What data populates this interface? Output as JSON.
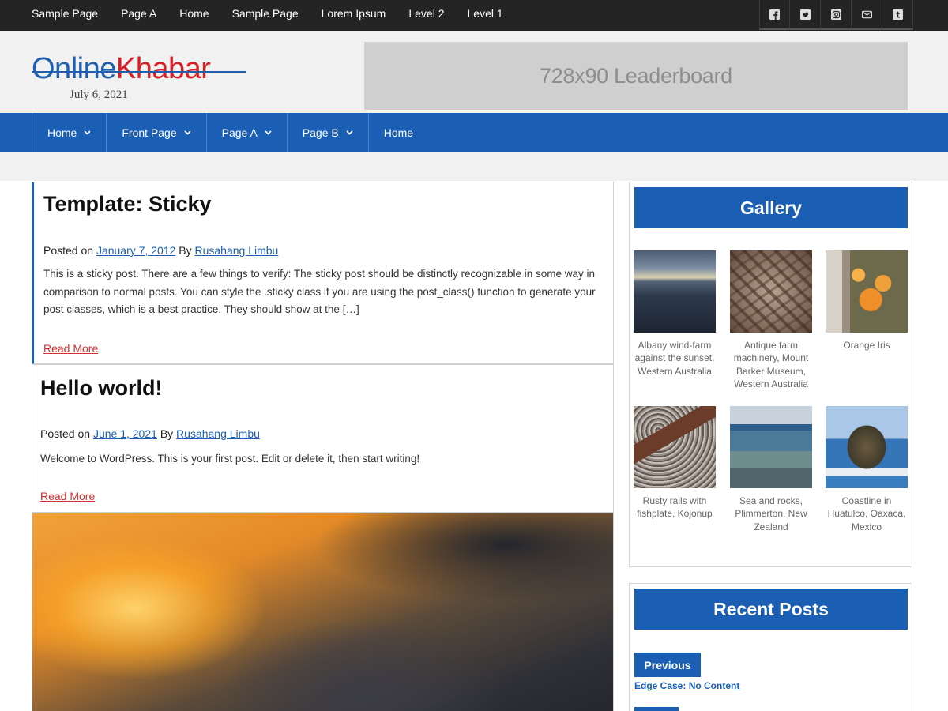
{
  "top_nav": {
    "items": [
      "Sample Page",
      "Page A",
      "Home",
      "Sample Page",
      "Lorem Ipsum",
      "Level 2",
      "Level 1"
    ]
  },
  "social_icons": [
    "facebook-icon",
    "twitter-icon",
    "instagram-icon",
    "email-icon",
    "tumblr-icon"
  ],
  "site": {
    "logo_part1": "Online",
    "logo_part2": "Khabar",
    "date": "July 6, 2021",
    "ad_label": "728x90 Leaderboard"
  },
  "main_nav": {
    "items": [
      {
        "label": "Home",
        "has_dropdown": true
      },
      {
        "label": "Front Page",
        "has_dropdown": true
      },
      {
        "label": "Page A",
        "has_dropdown": true
      },
      {
        "label": "Page B",
        "has_dropdown": true
      },
      {
        "label": "Home",
        "has_dropdown": false
      }
    ]
  },
  "posts": [
    {
      "title": "Template: Sticky",
      "posted_on_label": "Posted on",
      "date": "January 7, 2012",
      "by_label": "By",
      "author": "Rusahang Limbu",
      "excerpt": "This is a sticky post. There are a few things to verify: The sticky post should be distinctly recognizable in some way in comparison to normal posts. You can style the .sticky class if you are using the post_class() function to generate your post classes, which is a best practice. They should show at the […]",
      "read_more": "Read More"
    },
    {
      "title": "Hello world!",
      "posted_on_label": "Posted on",
      "date": "June 1, 2021",
      "by_label": "By",
      "author": "Rusahang Limbu",
      "excerpt": "Welcome to WordPress. This is your first post. Edit or delete it, then start writing!",
      "read_more": "Read More"
    }
  ],
  "sidebar": {
    "gallery": {
      "title": "Gallery",
      "items": [
        {
          "caption": "Albany wind-farm against the sunset, Western Australia"
        },
        {
          "caption": "Antique farm machinery, Mount Barker Museum, Western Australia"
        },
        {
          "caption": "Orange Iris"
        },
        {
          "caption": "Rusty rails with fishplate, Kojonup"
        },
        {
          "caption": "Sea and rocks, Plimmerton, New Zealand"
        },
        {
          "caption": "Coastline in Huatulco, Oaxaca, Mexico"
        }
      ]
    },
    "recent_posts": {
      "title": "Recent Posts",
      "previous_label": "Previous",
      "first_post": "Edge Case: No Content"
    }
  },
  "colors": {
    "primary_blue": "#1a5fb4",
    "top_bar": "#242424",
    "read_more_red": "#d32f2f",
    "logo_red": "#d81f26"
  }
}
